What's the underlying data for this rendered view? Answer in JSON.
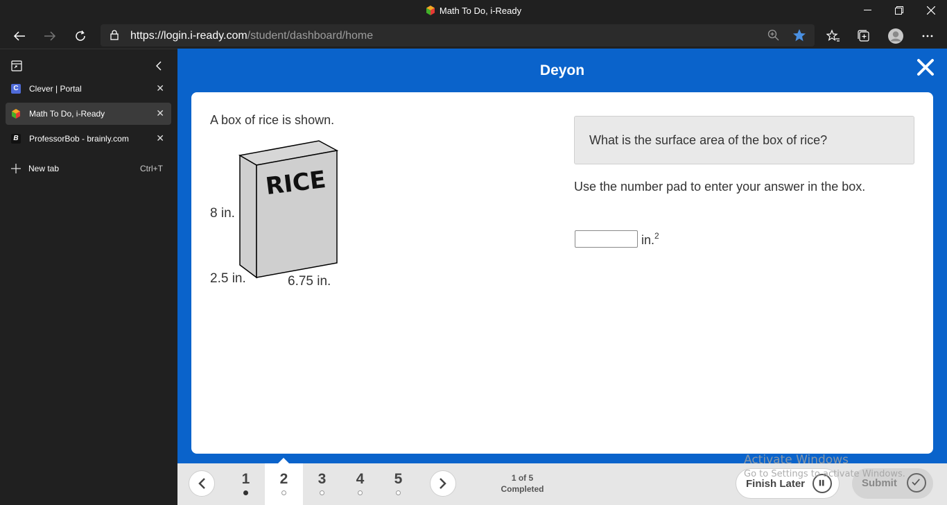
{
  "window": {
    "title": "Math To Do, i-Ready",
    "controls": {
      "minimize": "—",
      "restore": "❐",
      "close": "✕"
    }
  },
  "address_bar": {
    "url_host": "https://login.i-ready.com",
    "url_path": "/student/dashboard/home"
  },
  "sidebar": {
    "tabs": [
      {
        "label": "Clever | Portal",
        "icon": "clever-favicon",
        "color": "#4f6bd8",
        "glyph": "C",
        "active": false
      },
      {
        "label": "Math To Do, i-Ready",
        "icon": "iready-favicon",
        "color": "#f5a623",
        "glyph": "",
        "active": true
      },
      {
        "label": "ProfessorBob - brainly.com",
        "icon": "brainly-favicon",
        "color": "#000000",
        "glyph": "B",
        "active": false
      }
    ],
    "close_glyph": "✕",
    "new_tab": {
      "label": "New tab",
      "shortcut": "Ctrl+T"
    }
  },
  "lesson": {
    "student_name": "Deyon",
    "prompt": "A box of rice is shown.",
    "box_label": "RICE",
    "dimensions": {
      "height": "8 in.",
      "depth": "2.5 in.",
      "width": "6.75 in."
    },
    "question": "What is the surface area of the box of rice?",
    "instruction": "Use the number pad to enter your answer in the box.",
    "answer_value": "",
    "unit": "in.",
    "unit_exponent": "2"
  },
  "navigation": {
    "questions": [
      {
        "number": "1",
        "completed": true,
        "current": false
      },
      {
        "number": "2",
        "completed": false,
        "current": true
      },
      {
        "number": "3",
        "completed": false,
        "current": false
      },
      {
        "number": "4",
        "completed": false,
        "current": false
      },
      {
        "number": "5",
        "completed": false,
        "current": false
      }
    ],
    "progress_count": "1 of 5",
    "progress_label": "Completed",
    "finish_later": "Finish Later",
    "submit": "Submit"
  },
  "watermark": {
    "line1": "Activate Windows",
    "line2": "Go to Settings to activate Windows."
  },
  "colors": {
    "brand_blue": "#0a63cb",
    "browser_chrome": "#202020",
    "bookmark_star": "#4a90e2"
  }
}
